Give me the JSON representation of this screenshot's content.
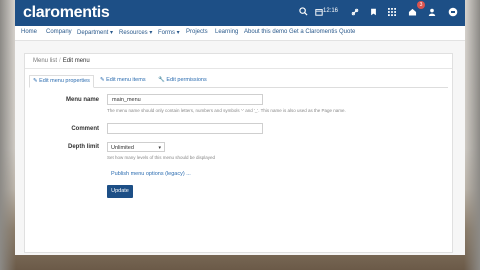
{
  "app": {
    "logo_text": "claromentis",
    "time_label": "12:16",
    "notification_count": "3",
    "topbar_icons": [
      "search-icon",
      "calendar-icon",
      "link-icon",
      "bookmark-icon",
      "apps-grid-icon",
      "home-icon",
      "user-icon",
      "settings-toggle-icon"
    ]
  },
  "nav": {
    "items": [
      "Home",
      "Company",
      "Department ▾",
      "Resources ▾",
      "Forms ▾",
      "Projects",
      "Learning",
      "About this demo",
      "Get a Claromentis Quote"
    ]
  },
  "breadcrumb": {
    "parent": "Menu list",
    "separator": "/",
    "current": "Edit menu"
  },
  "tabs": [
    {
      "icon": "✎",
      "label": "Edit menu properties"
    },
    {
      "icon": "✎",
      "label": "Edit menu items"
    },
    {
      "icon": "🔧",
      "label": "Edit permissions"
    }
  ],
  "form": {
    "menu_name_label": "Menu name",
    "menu_name_value": "main_menu",
    "menu_name_help": "The menu name should only contain letters, numbers and symbols '-' and '_'. This name is also used as the Page name.",
    "comment_label": "Comment",
    "comment_value": "",
    "depth_label": "Depth limit",
    "depth_value": "Unlimited",
    "depth_help": "Set how many levels of this menu should be displayed",
    "publish_link": "Publish menu options (legacy) ...",
    "update_button": "Update"
  }
}
